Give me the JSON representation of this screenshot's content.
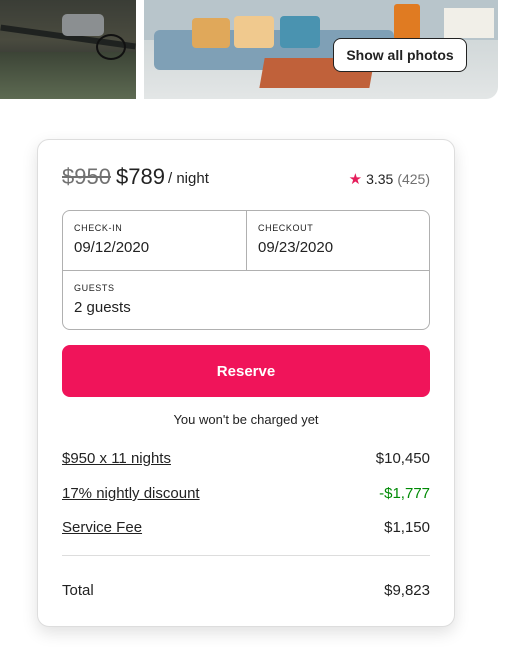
{
  "photos": {
    "show_all_label": "Show all photos"
  },
  "listing": {
    "original_price": "$950",
    "price": "$789",
    "per_night": "/ night",
    "rating": "3.35",
    "review_count": "(425)",
    "star_color": "#e51d5b"
  },
  "booking": {
    "checkin_label": "CHECK-IN",
    "checkin_value": "09/12/2020",
    "checkout_label": "CHECKOUT",
    "checkout_value": "09/23/2020",
    "guests_label": "GUESTS",
    "guests_value": "2 guests"
  },
  "reserve": {
    "label": "Reserve",
    "color": "#f0145a",
    "note": "You won't be charged yet"
  },
  "breakdown": [
    {
      "desc": "$950 x 11 nights",
      "amount": "$10,450"
    },
    {
      "desc": "17% nightly discount",
      "amount": "-$1,777",
      "amount_color": "#008a05"
    },
    {
      "desc": "Service Fee",
      "amount": "$1,150"
    }
  ],
  "total": {
    "label": "Total",
    "amount": "$9,823"
  }
}
